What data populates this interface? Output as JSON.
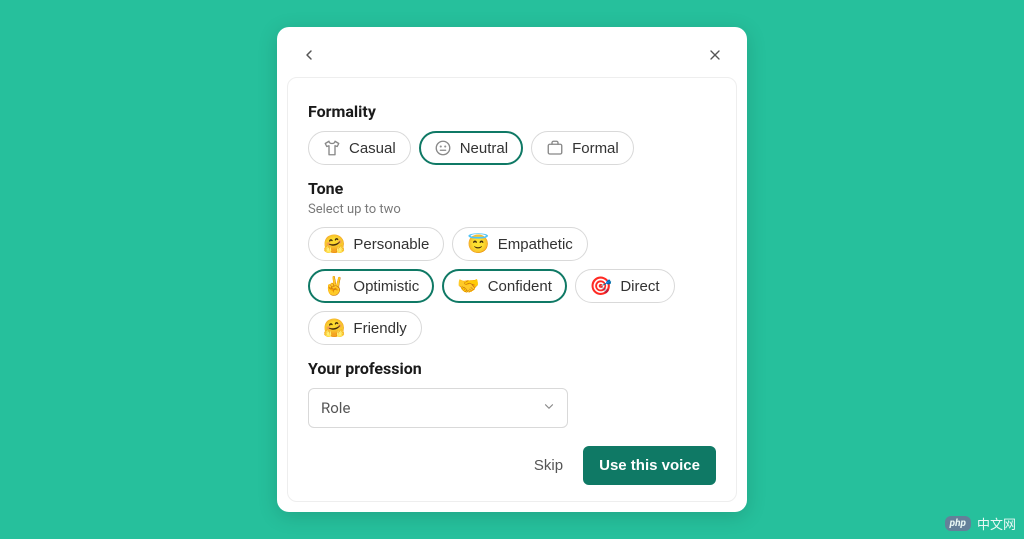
{
  "formality": {
    "title": "Formality",
    "options": [
      {
        "label": "Casual",
        "selected": false
      },
      {
        "label": "Neutral",
        "selected": true
      },
      {
        "label": "Formal",
        "selected": false
      }
    ]
  },
  "tone": {
    "title": "Tone",
    "subtitle": "Select up to two",
    "options": [
      {
        "emoji": "🤗",
        "label": "Personable",
        "selected": false
      },
      {
        "emoji": "😇",
        "label": "Empathetic",
        "selected": false
      },
      {
        "emoji": "✌️",
        "label": "Optimistic",
        "selected": true
      },
      {
        "emoji": "🤝",
        "label": "Confident",
        "selected": true
      },
      {
        "emoji": "🎯",
        "label": "Direct",
        "selected": false
      },
      {
        "emoji": "🤗",
        "label": "Friendly",
        "selected": false
      }
    ]
  },
  "profession": {
    "title": "Your profession",
    "selected": "Role"
  },
  "footer": {
    "skip": "Skip",
    "primary": "Use this voice"
  },
  "watermark": {
    "badge": "php",
    "text": "中文网"
  }
}
